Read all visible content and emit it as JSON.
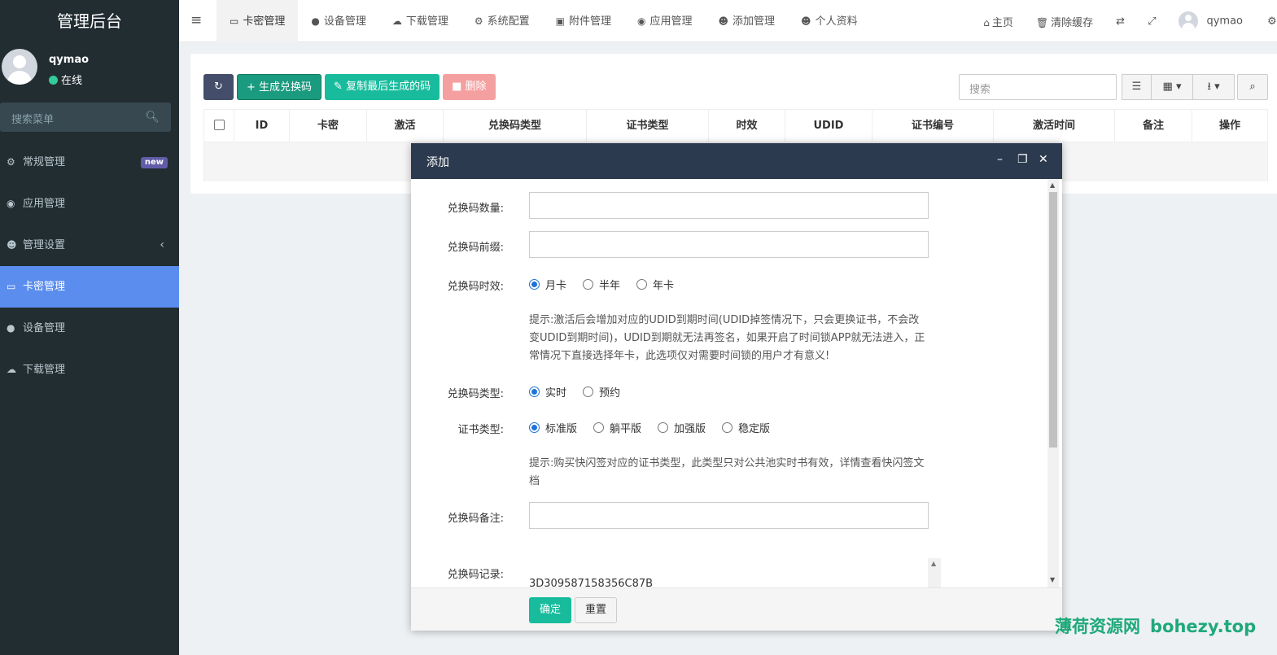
{
  "app": {
    "title": "管理后台"
  },
  "user": {
    "name": "qymao",
    "status": "在线",
    "online_color": "#33cc99"
  },
  "sidebar": {
    "search_placeholder": "搜索菜单",
    "items": [
      {
        "label": "常规管理",
        "icon": "cogs-icon",
        "badge": "new"
      },
      {
        "label": "应用管理",
        "icon": "app-store-icon"
      },
      {
        "label": "管理设置",
        "icon": "users-icon",
        "chevron": "‹"
      },
      {
        "label": "卡密管理",
        "icon": "credit-card-icon",
        "active": true
      },
      {
        "label": "设备管理",
        "icon": "apple-icon"
      },
      {
        "label": "下载管理",
        "icon": "cloud-download-icon"
      }
    ],
    "active_color": "#5b8def",
    "bg_color": "#222d32"
  },
  "topnav": {
    "tabs": [
      {
        "label": "卡密管理",
        "icon": "credit-card-icon",
        "active": true
      },
      {
        "label": "设备管理",
        "icon": "apple-icon"
      },
      {
        "label": "下载管理",
        "icon": "cloud-download-icon"
      },
      {
        "label": "系统配置",
        "icon": "gear-icon"
      },
      {
        "label": "附件管理",
        "icon": "image-icon"
      },
      {
        "label": "应用管理",
        "icon": "app-store-icon"
      },
      {
        "label": "添加管理",
        "icon": "user-icon"
      },
      {
        "label": "个人资料",
        "icon": "user-icon"
      }
    ],
    "home": "主页",
    "clear_cache": "清除缓存",
    "username": "qymao"
  },
  "toolbar": {
    "generate": "生成兑换码",
    "copy_last": "复制最后生成的码",
    "delete": "删除",
    "search_placeholder": "搜索"
  },
  "table": {
    "columns": [
      "ID",
      "卡密",
      "激活",
      "兑换码类型",
      "证书类型",
      "时效",
      "UDID",
      "证书编号",
      "激活时间",
      "备注",
      "操作"
    ]
  },
  "modal": {
    "title": "添加",
    "fields": {
      "quantity_label": "兑换码数量:",
      "prefix_label": "兑换码前缀:",
      "validity_label": "兑换码时效:",
      "validity_options": [
        "月卡",
        "半年",
        "年卡"
      ],
      "validity_hint": "提示:激活后会增加对应的UDID到期时间(UDID掉签情况下，只会更换证书，不会改变UDID到期时间)，UDID到期就无法再签名，如果开启了时间锁APP就无法进入，正常情况下直接选择年卡，此选项仅对需要时间锁的用户才有意义!",
      "type_label": "兑换码类型:",
      "type_options": [
        "实时",
        "预约"
      ],
      "cert_label": "证书类型:",
      "cert_options": [
        "标准版",
        "躺平版",
        "加强版",
        "稳定版"
      ],
      "cert_hint": "提示:购买快闪签对应的证书类型，此类型只对公共池实时书有效，详情查看快闪签文档",
      "remark_label": "兑换码备注:",
      "record_label": "兑换码记录:",
      "record_value": "3D309587158356C87B"
    },
    "ok": "确定",
    "reset": "重置"
  },
  "watermark": {
    "cn": "薄荷资源网",
    "en": "bohezy.top"
  }
}
